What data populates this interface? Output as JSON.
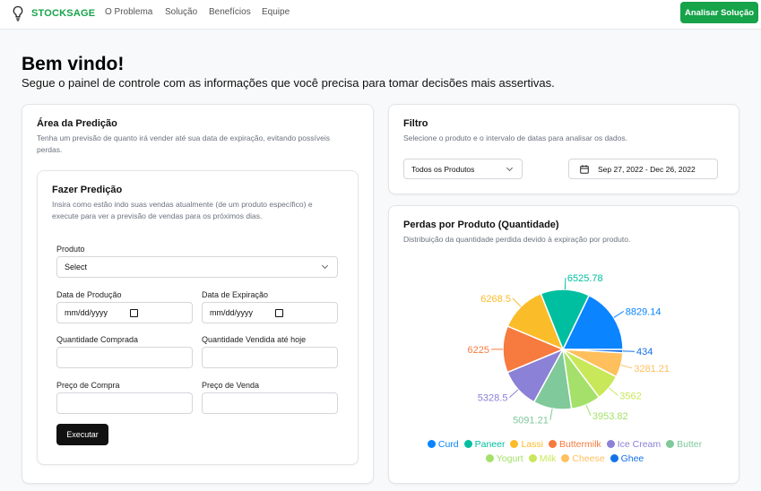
{
  "header": {
    "brand": "STOCKSAGE",
    "nav": [
      "O Problema",
      "Solução",
      "Benefícios",
      "Equipe"
    ],
    "cta_label": "Analisar Solução",
    "accent_color": "#16a34a"
  },
  "welcome": {
    "title": "Bem vindo!",
    "subtitle": "Segue o painel de controle com as informações que você precisa para tomar decisões mais assertivas."
  },
  "prediction": {
    "title": "Área da Predição",
    "desc_line1": "Tenha um previsão de quanto irá vender até sua data de expiração, evitando possíveis",
    "desc_line2": "perdas.",
    "inner_title": "Fazer Predição",
    "inner_desc_line1": "Insira como estão indo suas vendas atualmente (de um produto específico) e",
    "inner_desc_line2": "execute para ver a previsão de vendas para os próximos dias.",
    "product_label": "Produto",
    "product_value": "Select",
    "prod_date_label": "Data de Produção",
    "prod_date_placeholder": "mm/dd/yyyy",
    "exp_date_label": "Data de Expiração",
    "exp_date_placeholder": "mm/dd/yyyy",
    "qty_bought_label": "Quantidade Comprada",
    "qty_sold_label": "Quantidade Vendida até hoje",
    "buy_price_label": "Preço de Compra",
    "sell_price_label": "Preço de Venda",
    "execute_label": "Executar"
  },
  "filter": {
    "title": "Filtro",
    "desc": "Selecione o produto e o intervalo de datas para analisar os dados.",
    "product_value": "Todos os Produtos",
    "date_range": "Sep 27, 2022 - Dec 26, 2022"
  },
  "losses": {
    "title": "Perdas por Produto (Quantidade)",
    "desc": "Distribuição da quantidade perdida devido à expiração por produto."
  },
  "chart_data": {
    "type": "pie",
    "categories": [
      "Curd",
      "Paneer",
      "Lassi",
      "Buttermilk",
      "Ice Cream",
      "Butter",
      "Yogurt",
      "Milk",
      "Cheese",
      "Ghee"
    ],
    "values": [
      8829.14,
      6525.78,
      6268.5,
      6225,
      5328.5,
      5091.21,
      3953.82,
      3562,
      3281.21,
      434
    ],
    "label_text": [
      "8829.14",
      "6525.78",
      "6268.5",
      "6225",
      "5328.5",
      "5091.21",
      "3953.82",
      "3562",
      "3281.21",
      "434"
    ],
    "colors": [
      "#0a84ff",
      "#00bfa0",
      "#fbbc29",
      "#f77a3e",
      "#8b81d6",
      "#7fc99a",
      "#a4e06a",
      "#c8e85a",
      "#ffbf5c",
      "#1472e8"
    ],
    "legend_placement": "bottom"
  }
}
